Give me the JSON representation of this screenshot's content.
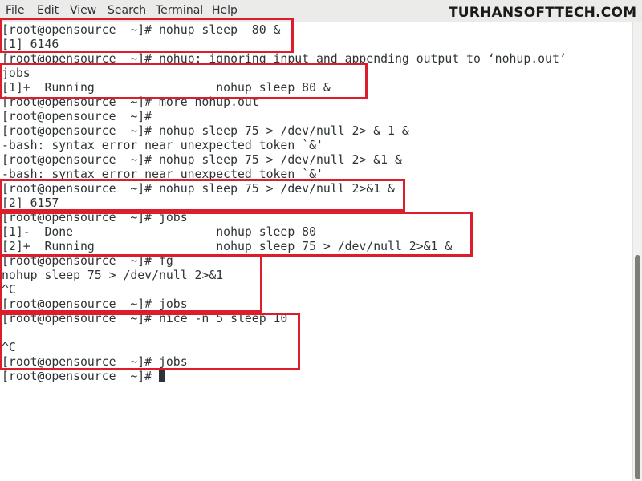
{
  "menu": [
    "File",
    "Edit",
    "View",
    "Search",
    "Terminal",
    "Help"
  ],
  "watermark": "TURHANSOFTTECH.COM",
  "terminal": {
    "lines": [
      "[root@opensource  ~]# nohup sleep  80 &",
      "[1] 6146",
      "[root@opensource  ~]# nohup: ignoring input and appending output to ‘nohup.out’",
      "jobs",
      "[1]+  Running                 nohup sleep 80 &",
      "[root@opensource  ~]# more nohup.out",
      "[root@opensource  ~]#",
      "[root@opensource  ~]# nohup sleep 75 > /dev/null 2> & 1 &",
      "-bash: syntax error near unexpected token `&'",
      "[root@opensource  ~]# nohup sleep 75 > /dev/null 2> &1 &",
      "-bash: syntax error near unexpected token `&'",
      "[root@opensource  ~]# nohup sleep 75 > /dev/null 2>&1 &",
      "[2] 6157",
      "[root@opensource  ~]# jobs",
      "[1]-  Done                    nohup sleep 80",
      "[2]+  Running                 nohup sleep 75 > /dev/null 2>&1 &",
      "[root@opensource  ~]# fg",
      "nohup sleep 75 > /dev/null 2>&1",
      "^C",
      "[root@opensource  ~]# jobs",
      "[root@opensource  ~]# nice -n 5 sleep 10",
      "",
      "^C",
      "[root@opensource  ~]# jobs",
      "[root@opensource  ~]# "
    ]
  },
  "colors": {
    "highlight": "#dd1c2c",
    "text": "#2e3436",
    "background": "#ffffff"
  }
}
